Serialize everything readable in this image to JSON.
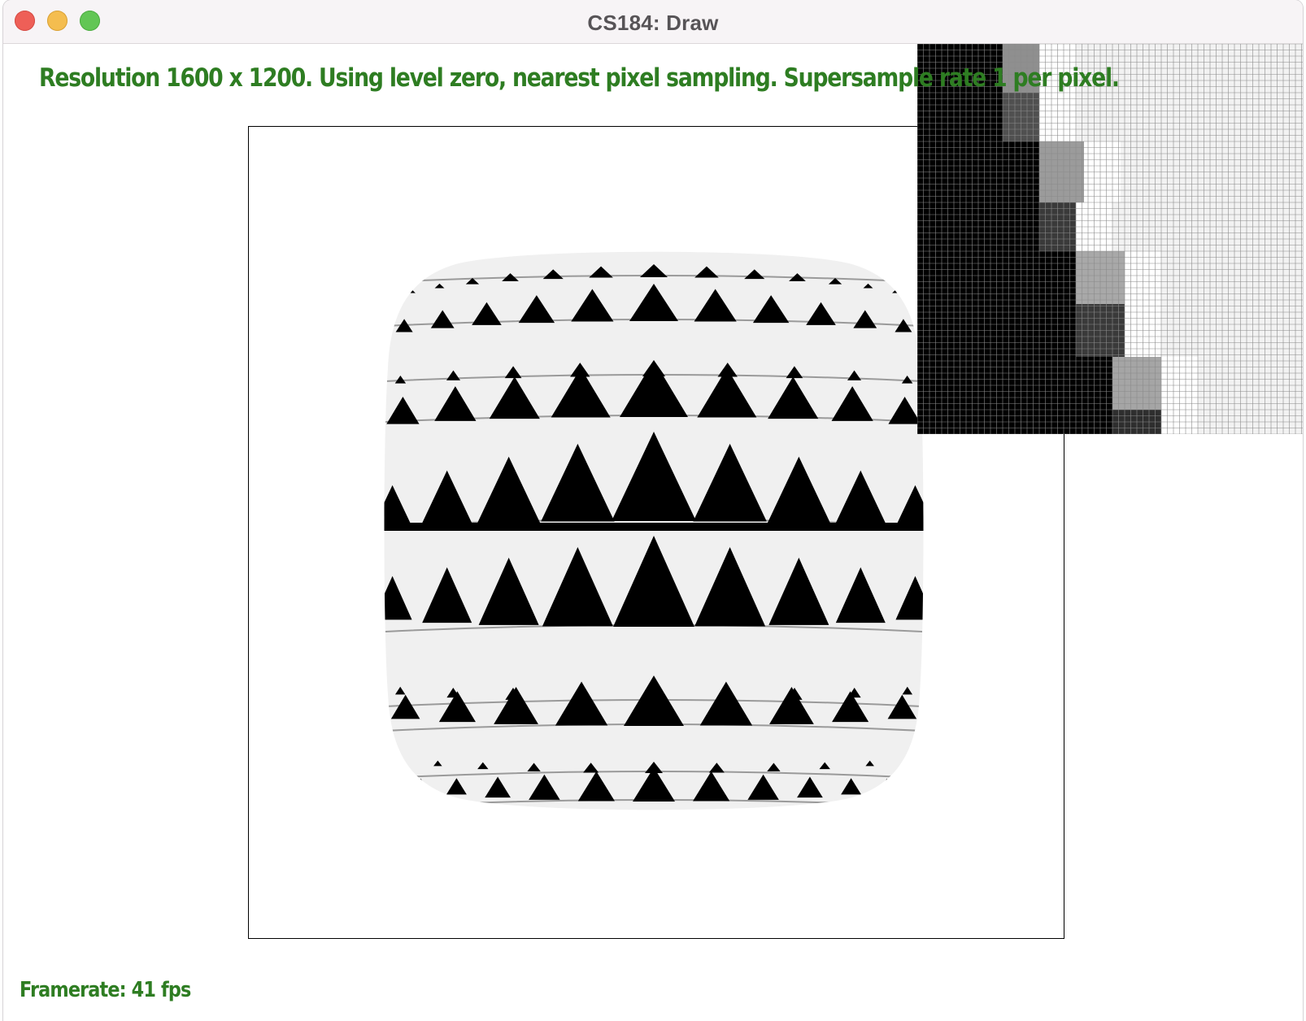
{
  "window": {
    "title": "CS184: Draw"
  },
  "overlay": {
    "info_text": "Resolution 1600 x 1200. Using level zero, nearest pixel sampling. Supersample rate 1 per pixel.",
    "framerate_text": "Framerate: 41 fps",
    "text_color": "#2e7d22"
  },
  "colors": {
    "close": "#ee5f57",
    "minimize": "#f4bd4f",
    "maximize": "#62c655"
  }
}
